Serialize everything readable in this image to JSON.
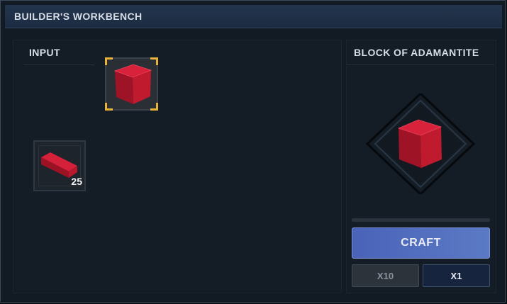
{
  "window": {
    "title": "BUILDER'S WORKBENCH"
  },
  "input": {
    "label": "INPUT",
    "selected_slot": {
      "item": "adamantite-block-icon"
    },
    "ingredient_slot": {
      "item": "adamantite-ingot-icon",
      "count": "25"
    }
  },
  "output": {
    "label": "BLOCK OF ADAMANTITE",
    "item": "adamantite-block-icon",
    "progress": 0
  },
  "actions": {
    "craft_label": "CRAFT",
    "x10_label": "X10",
    "x1_label": "X1"
  },
  "colors": {
    "accent_gold": "#e6b23a",
    "craft_blue": "#4a63b8",
    "item_red": "#b0152a",
    "title_bar": "#22344d"
  }
}
